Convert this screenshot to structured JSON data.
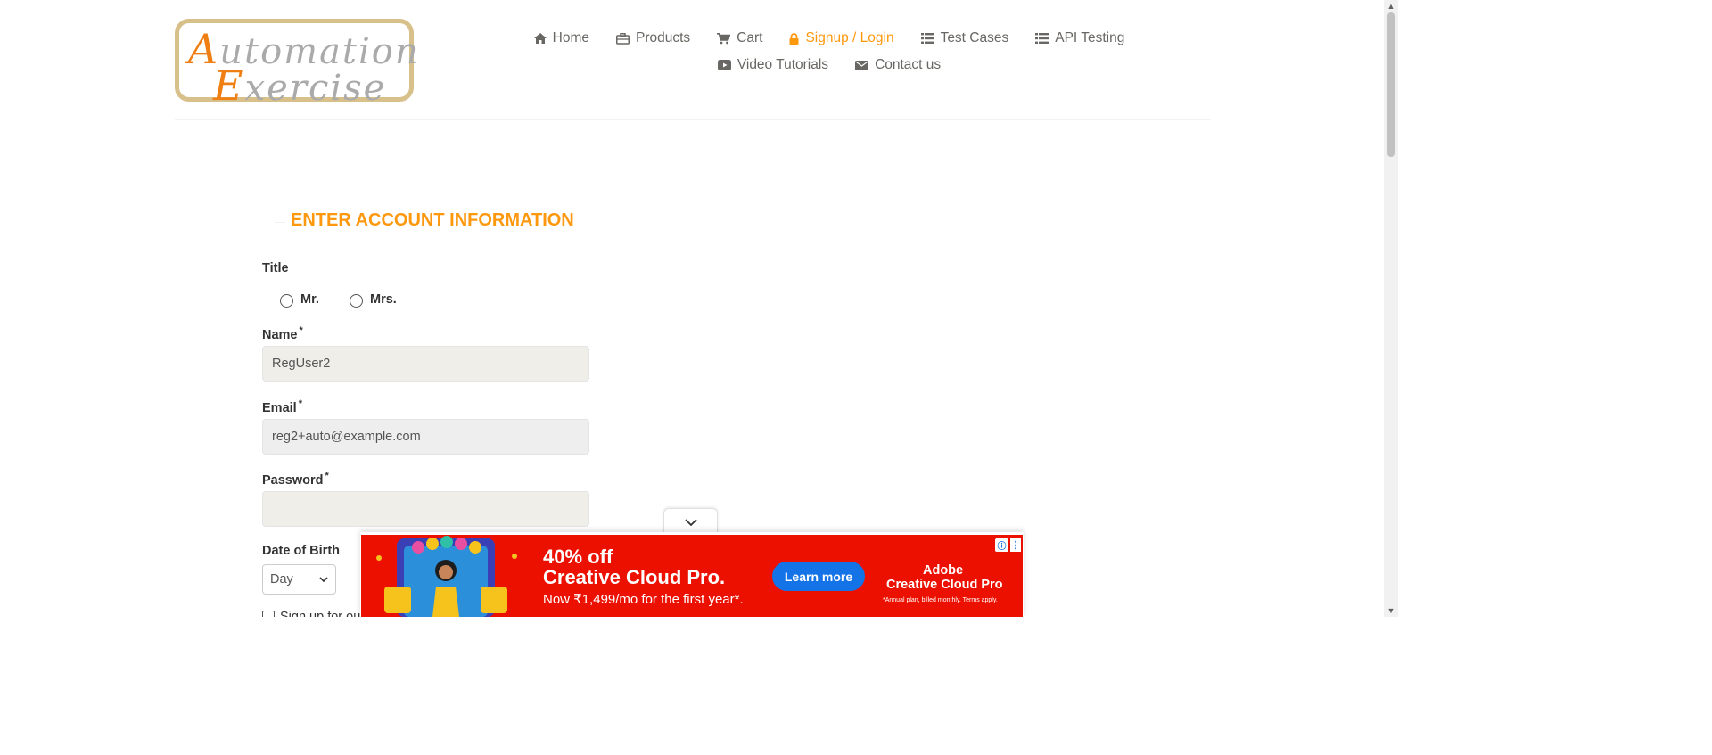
{
  "header": {
    "logo": {
      "line1_cap": "A",
      "line1_rest": "utomation",
      "line2_cap": "E",
      "line2_rest": "xercise"
    },
    "nav": {
      "home": "Home",
      "products": "Products",
      "cart": "Cart",
      "signup_login": "Signup / Login",
      "test_cases": "Test Cases",
      "api_testing": "API Testing",
      "video_tutorials": "Video Tutorials",
      "contact_us": "Contact us"
    },
    "active_color": "#fe980f"
  },
  "form": {
    "title": "ENTER ACCOUNT INFORMATION",
    "title_label": "Title",
    "title_options": [
      "Mr.",
      "Mrs."
    ],
    "name_label": "Name",
    "name_value": "RegUser2",
    "email_label": "Email",
    "email_value": "reg2+auto@example.com",
    "password_label": "Password",
    "password_value": "",
    "required_mark": "*",
    "dob_label": "Date of Birth",
    "dob_day": "Day",
    "newsletter_label": "Sign up for our newsletter!"
  },
  "ad": {
    "headline1": "40% off",
    "headline2": "Creative Cloud Pro.",
    "subtext": "Now ₹1,499/mo for the first year*.",
    "cta": "Learn more",
    "brand_line1": "Adobe",
    "brand_line2": "Creative Cloud Pro",
    "fine_print": "*Annual plan, billed monthly. Terms apply.",
    "info_glyph": "ⓘ",
    "menu_glyph": "⋮",
    "background": "#eb1000",
    "cta_color": "#1473e6"
  }
}
